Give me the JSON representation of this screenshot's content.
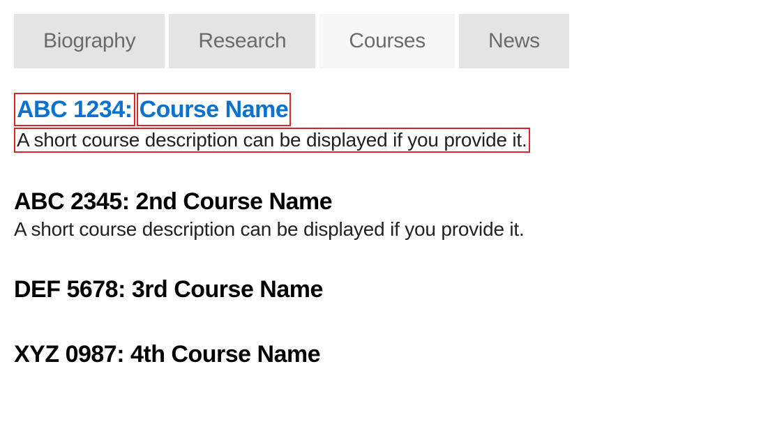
{
  "tabs": {
    "items": [
      {
        "label": "Biography",
        "active": false
      },
      {
        "label": "Research",
        "active": false
      },
      {
        "label": "Courses",
        "active": true
      },
      {
        "label": "News",
        "active": false
      }
    ]
  },
  "courses": [
    {
      "code": "ABC 1234:",
      "name": "Course Name",
      "desc": "A short course description can be displayed if you provide it.",
      "linked": true,
      "boxed": true,
      "descBoxed": true
    },
    {
      "code": "ABC 2345:",
      "name": "2nd Course Name",
      "desc": "A short course description can be displayed if you provide it.",
      "linked": false,
      "boxed": false,
      "descBoxed": false
    },
    {
      "code": "DEF 5678:",
      "name": "3rd Course Name",
      "desc": "",
      "linked": false,
      "boxed": false,
      "descBoxed": false
    },
    {
      "code": "XYZ 0987:",
      "name": "4th Course Name",
      "desc": "",
      "linked": false,
      "boxed": false,
      "descBoxed": false
    }
  ]
}
